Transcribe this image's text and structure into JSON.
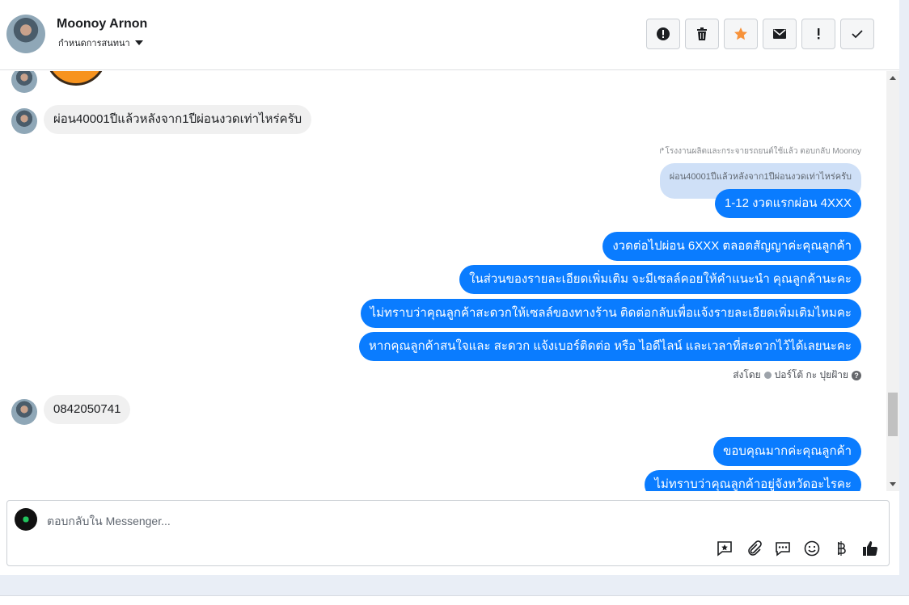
{
  "header": {
    "name": "Moonoy Arnon",
    "subtitle": "กำหนดการสนทนา",
    "tools": [
      {
        "name": "spam-alert-icon"
      },
      {
        "name": "trash-icon"
      },
      {
        "name": "star-icon",
        "color": "#f7923a"
      },
      {
        "name": "envelope-icon"
      },
      {
        "name": "exclamation-icon"
      },
      {
        "name": "check-icon"
      }
    ]
  },
  "thread": {
    "incoming_1": "ผ่อน40001ปีแล้วหลังจาก1ปีผ่อนงวดเท่าไหร่ครับ",
    "reply_note": "โรงงานผลิตและกระจายรถยนต์ใช้แล้ว ตอบกลับ Moonoy",
    "quoted": "ผ่อน40001ปีแล้วหลังจาก1ปีผ่อนงวดเท่าไหร่ครับ",
    "outgoing": [
      "1-12 งวดแรกผ่อน 4XXX",
      "งวดต่อไปผ่อน 6XXX ตลอดสัญญาค่ะคุณลูกค้า",
      "ในส่วนของรายละเอียดเพิ่มเติม จะมีเซลล์คอยให้คำแนะนำ คุณลูกค้านะคะ",
      "ไม่ทราบว่าคุณลูกค้าสะดวกให้เซลล์ของทางร้าน ติดต่อกลับเพื่อแจ้งรายละเอียดเพิ่มเติมไหมคะ",
      "หากคุณลูกค้าสนใจและ สะดวก แจ้งเบอร์ติดต่อ หรือ ไอดีไลน์ และเวลาที่สะดวกไว้ได้เลยนะคะ"
    ],
    "sent_by_prefix": "ส่งโดย",
    "sent_by_name": "ปอร์โต้ กะ ปุยฝ้าย",
    "incoming_2": "0842050741",
    "outgoing_2": [
      "ขอบคุณมากค่ะคุณลูกค้า",
      "ไม่ทราบว่าคุณลูกค้าอยู่จังหวัดอะไรคะ"
    ]
  },
  "composer": {
    "placeholder": "ตอบกลับใน Messenger...",
    "tools": [
      "saved-reply-icon",
      "attachment-icon",
      "chat-bubble-icon",
      "emoji-icon",
      "baht-icon",
      "thumbs-up-icon"
    ]
  },
  "colors": {
    "accent": "#0a7cff",
    "incoming_bg": "#f0f0f0",
    "quote_bg": "#cfe0f7"
  }
}
